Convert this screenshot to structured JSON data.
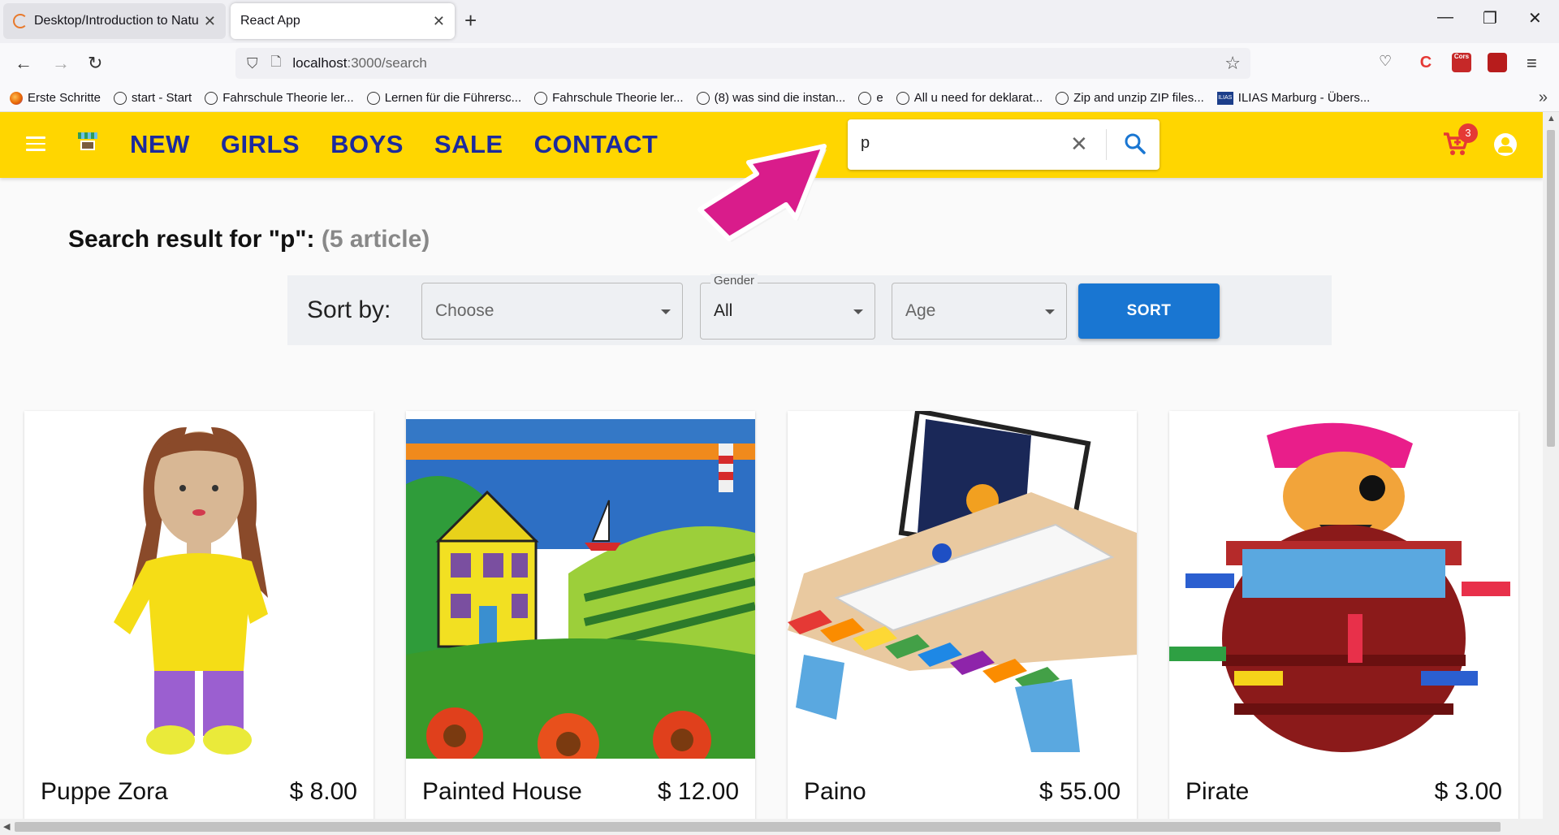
{
  "browser": {
    "tabs": [
      {
        "title": "Desktop/Introduction to Natur..."
      },
      {
        "title": "React App"
      }
    ],
    "url_host": "localhost",
    "url_path": ":3000/search",
    "bookmarks": [
      "Erste Schritte",
      "start - Start",
      "Fahrschule Theorie ler...",
      "Lernen für die Führersc...",
      "Fahrschule Theorie ler...",
      "(8) was sind die instan...",
      "e",
      "All u need for deklarat...",
      "Zip and unzip ZIP files...",
      "ILIAS Marburg - Übers..."
    ]
  },
  "nav": {
    "menu": [
      "NEW",
      "GIRLS",
      "BOYS",
      "SALE",
      "CONTACT"
    ],
    "search_value": "p",
    "cart_count": "3",
    "colors": {
      "bar": "#ffd600",
      "menu": "#1b2a9e",
      "accent": "#1976d2"
    }
  },
  "search_result": {
    "label": "Search result for \"p\":",
    "count": "(5 article)"
  },
  "sort": {
    "label": "Sort by:",
    "sort_select": "Choose",
    "gender_legend": "Gender",
    "gender_select": "All",
    "age_select": "Age",
    "button": "SORT"
  },
  "products": [
    {
      "name": "Puppe Zora",
      "price": "$ 8.00"
    },
    {
      "name": "Painted House",
      "price": "$ 12.00"
    },
    {
      "name": "Paino",
      "price": "$ 55.00"
    },
    {
      "name": "Pirate",
      "price": "$ 3.00"
    }
  ]
}
